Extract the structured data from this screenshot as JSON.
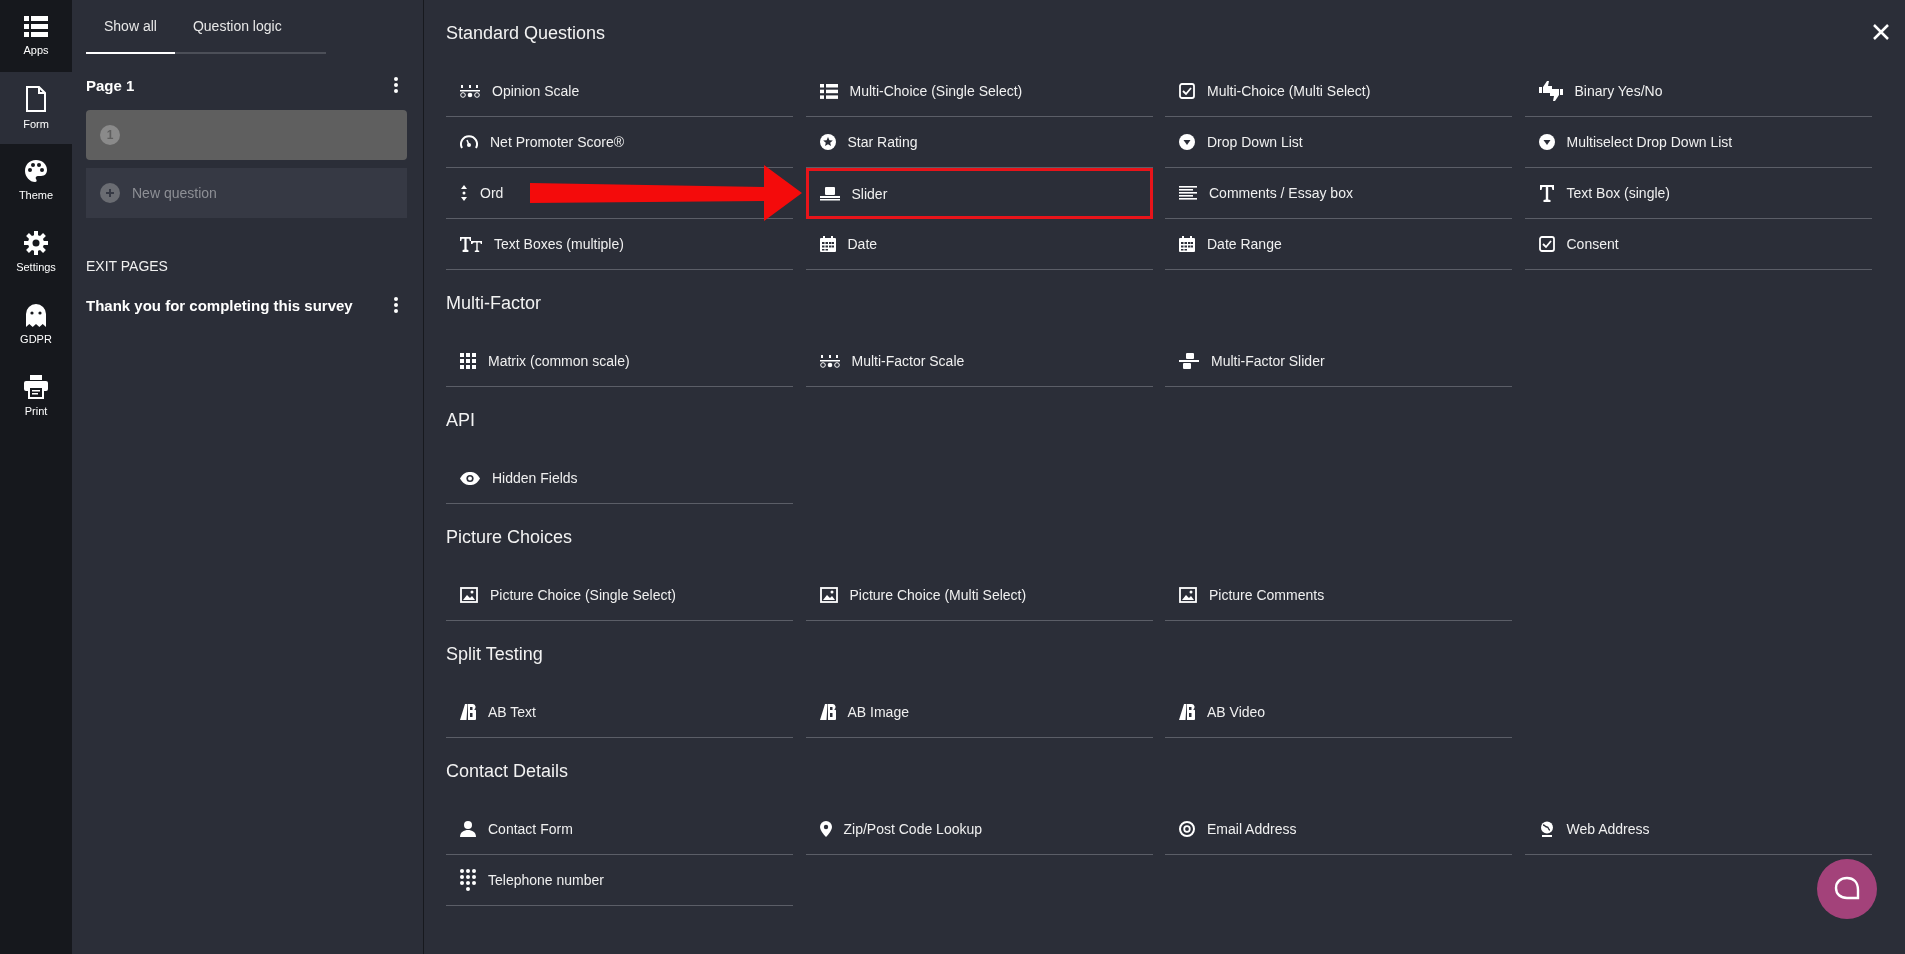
{
  "rail": [
    {
      "label": "Apps",
      "selected": false
    },
    {
      "label": "Form",
      "selected": true
    },
    {
      "label": "Theme",
      "selected": false
    },
    {
      "label": "Settings",
      "selected": false
    },
    {
      "label": "GDPR",
      "selected": false
    },
    {
      "label": "Print",
      "selected": false
    }
  ],
  "panel": {
    "tabs": [
      {
        "label": "Show all",
        "selected": true
      },
      {
        "label": "Question logic",
        "selected": false
      }
    ],
    "page_title": "Page 1",
    "questions": [
      {
        "number": "1"
      }
    ],
    "new_question": "New question",
    "exit_heading": "EXIT PAGES",
    "exit_pages": [
      "Thank you for completing this survey"
    ]
  },
  "library": {
    "sections": [
      {
        "title": "Standard Questions",
        "items": [
          {
            "label": "Opinion Scale",
            "highlighted": false
          },
          {
            "label": "Multi-Choice (Single Select)",
            "highlighted": false
          },
          {
            "label": "Multi-Choice (Multi Select)",
            "highlighted": false
          },
          {
            "label": "Binary Yes/No",
            "highlighted": false
          },
          {
            "label": "Net Promoter Score®",
            "highlighted": false
          },
          {
            "label": "Star Rating",
            "highlighted": false
          },
          {
            "label": "Drop Down List",
            "highlighted": false
          },
          {
            "label": "Multiselect Drop Down List",
            "highlighted": false
          },
          {
            "label": "Ord",
            "highlighted": false
          },
          {
            "label": "Slider",
            "highlighted": true
          },
          {
            "label": "Comments / Essay box",
            "highlighted": false
          },
          {
            "label": "Text Box (single)",
            "highlighted": false
          },
          {
            "label": "Text Boxes (multiple)",
            "highlighted": false
          },
          {
            "label": "Date",
            "highlighted": false
          },
          {
            "label": "Date Range",
            "highlighted": false
          },
          {
            "label": "Consent",
            "highlighted": false
          }
        ]
      },
      {
        "title": "Multi-Factor",
        "items": [
          {
            "label": "Matrix (common scale)",
            "highlighted": false
          },
          {
            "label": "Multi-Factor Scale",
            "highlighted": false
          },
          {
            "label": "Multi-Factor Slider",
            "highlighted": false
          }
        ]
      },
      {
        "title": "API",
        "items": [
          {
            "label": "Hidden Fields",
            "highlighted": false
          }
        ]
      },
      {
        "title": "Picture Choices",
        "items": [
          {
            "label": "Picture Choice (Single Select)",
            "highlighted": false
          },
          {
            "label": "Picture Choice (Multi Select)",
            "highlighted": false
          },
          {
            "label": "Picture Comments",
            "highlighted": false
          }
        ]
      },
      {
        "title": "Split Testing",
        "items": [
          {
            "label": "AB Text",
            "highlighted": false
          },
          {
            "label": "AB Image",
            "highlighted": false
          },
          {
            "label": "AB Video",
            "highlighted": false
          }
        ]
      },
      {
        "title": "Contact Details",
        "items": [
          {
            "label": "Contact Form",
            "highlighted": false
          },
          {
            "label": "Zip/Post Code Lookup",
            "highlighted": false
          },
          {
            "label": "Email Address",
            "highlighted": false
          },
          {
            "label": "Web Address",
            "highlighted": false
          },
          {
            "label": "Telephone number",
            "highlighted": false
          }
        ]
      }
    ]
  }
}
